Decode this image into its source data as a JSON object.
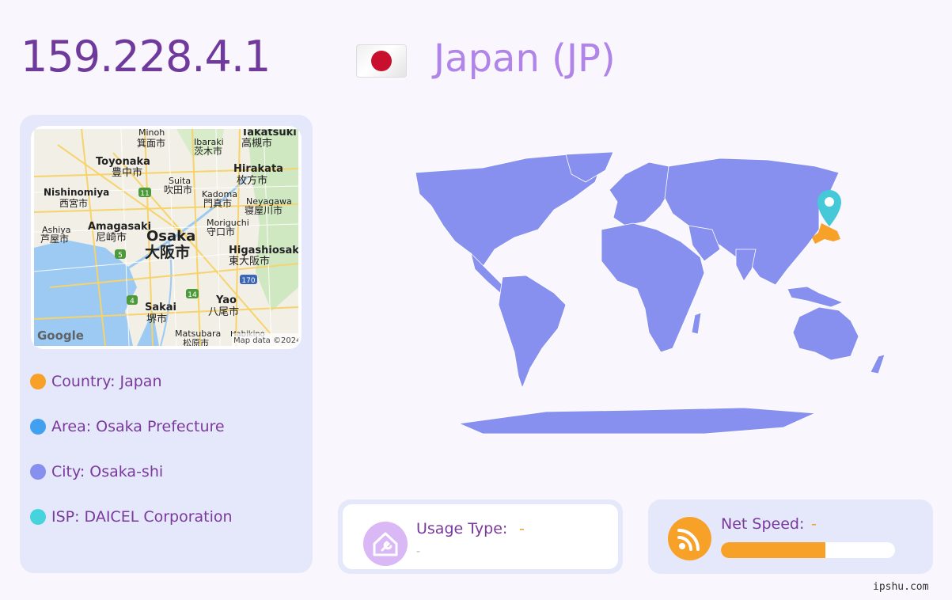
{
  "ip": "159.228.4.1",
  "country_title": "Japan (JP)",
  "colors": {
    "ip": "#6f3a9c",
    "title": "#b084e8",
    "card": "#e4e8fa",
    "accent": "#f7a128",
    "map_land": "#8790ee",
    "pin": "#45c9d8"
  },
  "map": {
    "labels": {
      "minoh": "Minoh",
      "minoh_jp": "箕面市",
      "ibaraki": "Ibaraki",
      "ibaraki_jp": "茨木市",
      "takatsuki": "Takatsuki",
      "takatsuki_jp": "高槻市",
      "toyonaka": "Toyonaka",
      "toyonaka_jp": "豊中市",
      "suita": "Suita",
      "suita_jp": "吹田市",
      "hirakata": "Hirakata",
      "hirakata_jp": "枚方市",
      "nishinomiya": "Nishinomiya",
      "nishinomiya_jp": "西宮市",
      "kadoma": "Kadoma",
      "kadoma_jp": "門真市",
      "neyagawa": "Neyagawa",
      "neyagawa_jp": "寝屋川市",
      "ashiya": "Ashiya",
      "ashiya_jp": "芦屋市",
      "amagasaki": "Amagasaki",
      "amagasaki_jp": "尼崎市",
      "moriguchi": "Moriguchi",
      "moriguchi_jp": "守口市",
      "osaka": "Osaka",
      "osaka_jp": "大阪市",
      "higashiosaka": "Higashiosaka",
      "higashiosaka_jp": "東大阪市",
      "sakai": "Sakai",
      "sakai_jp": "堺市",
      "yao": "Yao",
      "yao_jp": "八尾市",
      "matsubara": "Matsubara",
      "matsubara_jp": "松原市",
      "habikino": "Habikino",
      "route_11": "11",
      "route_5": "5",
      "route_170": "170",
      "route_14": "14",
      "route_4": "4"
    },
    "google": "Google",
    "attribution": "Map data ©2024"
  },
  "info": {
    "country_label": "Country:",
    "country_value": "Japan",
    "area_label": "Area:",
    "area_value": "Osaka Prefecture",
    "city_label": "City:",
    "city_value": "Osaka-shi",
    "isp_label": "ISP:",
    "isp_value": "DAICEL Corporation"
  },
  "usage": {
    "label": "Usage Type:",
    "value": "-",
    "sub": "-"
  },
  "speed": {
    "label": "Net Speed:",
    "value": "-",
    "level": 0.6
  },
  "watermark": "ipshu.com"
}
